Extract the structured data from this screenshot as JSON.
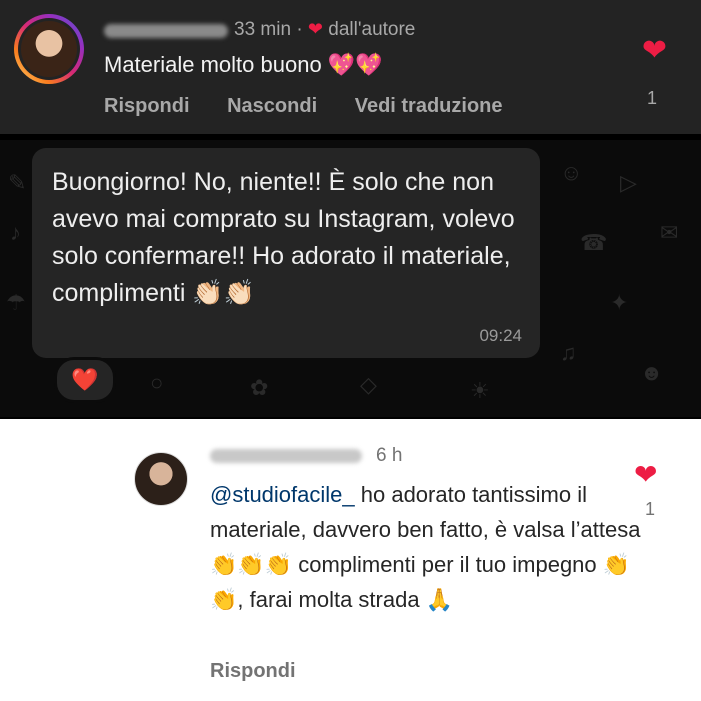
{
  "comment1": {
    "time": "33 min",
    "separator": "·",
    "author_badge": "dall'autore",
    "text": "Materiale molto buono 💖💖",
    "actions": [
      "Rispondi",
      "Nascondi",
      "Vedi traduzione"
    ],
    "like_count": "1"
  },
  "chat": {
    "message": "Buongiorno! No, niente!! È solo che non avevo mai comprato su Instagram, volevo solo confermare!! Ho adorato il materiale, complimenti 👏🏻👏🏻",
    "time": "09:24",
    "reaction": "❤️"
  },
  "comment2": {
    "time": "6 h",
    "mention": "@studiofacile_",
    "text": " ho adorato tantissimo il materiale, davvero ben fatto, è valsa l’attesa 👏👏👏 complimenti per il tuo impegno 👏👏, farai molta strada 🙏",
    "reply": "Rispondi",
    "like_count": "1"
  },
  "colors": {
    "heart": "#ed1d44",
    "mention": "#00376b"
  },
  "icons": [
    "heart-icon",
    "heart-reaction-icon"
  ]
}
